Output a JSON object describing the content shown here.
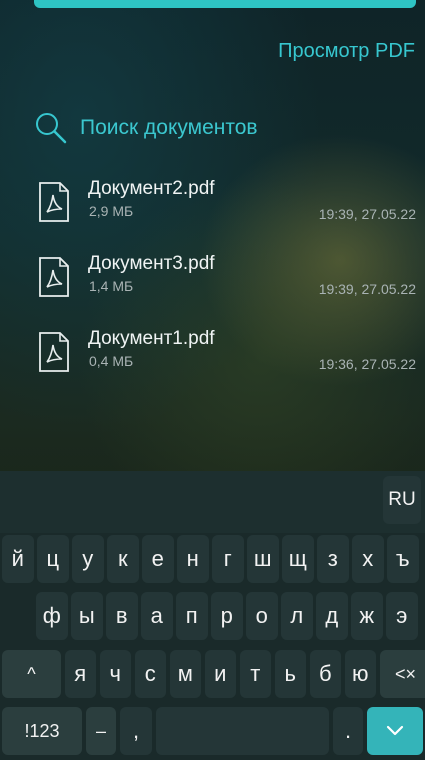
{
  "header": {
    "title": "Просмотр PDF"
  },
  "search": {
    "placeholder": "Поиск документов"
  },
  "documents": [
    {
      "name": "Документ2.pdf",
      "size": "2,9 МБ",
      "time": "19:39, 27.05.22"
    },
    {
      "name": "Документ3.pdf",
      "size": "1,4 МБ",
      "time": "19:39, 27.05.22"
    },
    {
      "name": "Документ1.pdf",
      "size": "0,4 МБ",
      "time": "19:36, 27.05.22"
    }
  ],
  "keyboard": {
    "lang": "RU",
    "row1": [
      "й",
      "ц",
      "у",
      "к",
      "е",
      "н",
      "г",
      "ш",
      "щ",
      "з",
      "х",
      "ъ"
    ],
    "row2": [
      "ф",
      "ы",
      "в",
      "а",
      "п",
      "р",
      "о",
      "л",
      "д",
      "ж",
      "э"
    ],
    "row3": [
      "я",
      "ч",
      "с",
      "м",
      "и",
      "т",
      "ь",
      "б",
      "ю"
    ],
    "shift": "^",
    "backspace": "<×",
    "symbols": "!123",
    "dash": "–",
    "comma": ",",
    "period": ".",
    "enter_icon": "chevron-down-icon"
  },
  "colors": {
    "accent": "#37c7cf",
    "enter": "#34b4b9"
  }
}
